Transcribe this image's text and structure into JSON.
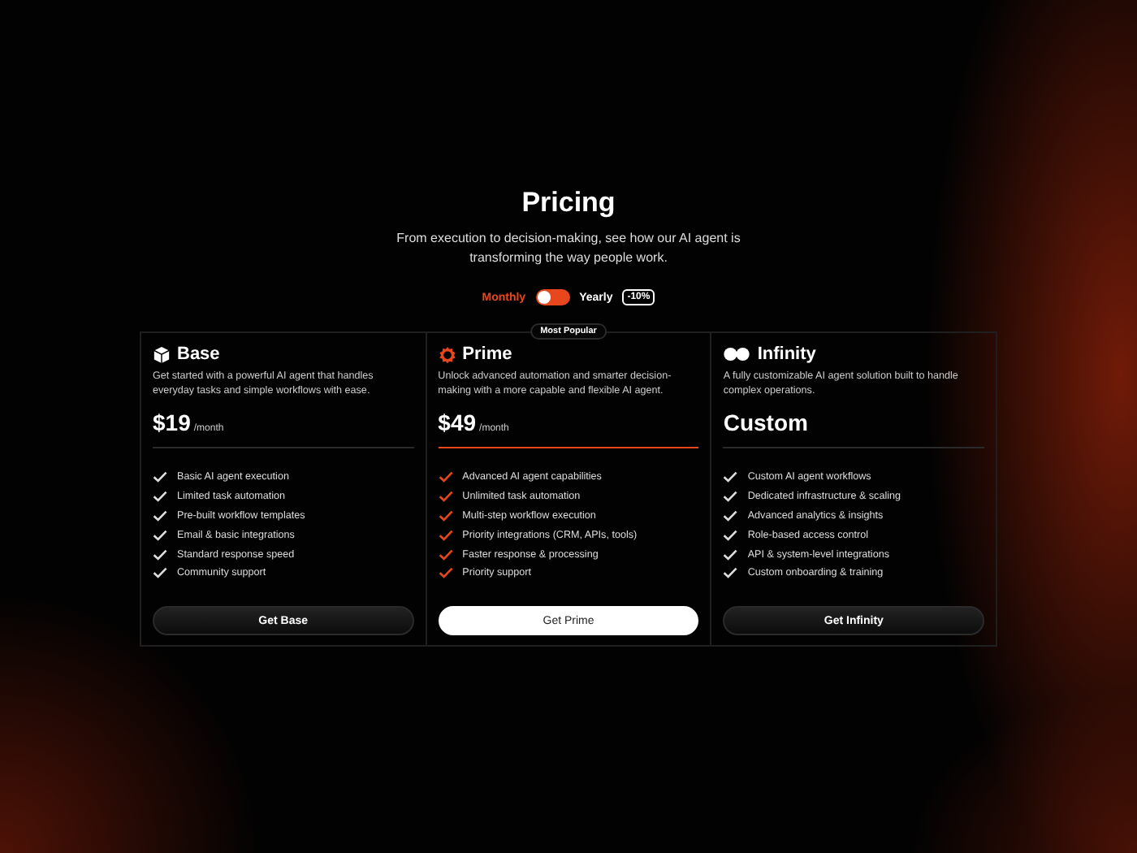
{
  "header": {
    "title": "Pricing",
    "subtitle": "From execution to decision-making, see how our AI agent is transforming the way people work."
  },
  "billing": {
    "options": [
      {
        "label": "Monthly",
        "selected": true
      },
      {
        "label": "Yearly",
        "selected": false
      }
    ],
    "discount": "-10%"
  },
  "plans": [
    {
      "name": "Base",
      "featured": false,
      "description": "Get started with a powerful AI agent that handles everyday tasks and simple workflows with ease.",
      "price": "$19",
      "period": "/month",
      "features": [
        "Basic AI agent execution",
        "Limited task automation",
        "Pre-built workflow templates",
        "Email & basic integrations",
        "Standard response speed",
        "Community support"
      ],
      "button": "Get Base"
    },
    {
      "name": "Prime",
      "featured": true,
      "badge": "Most Popular",
      "description": "Unlock advanced automation and smarter decision-making with a more capable and flexible AI agent.",
      "price": "$49",
      "period": "/month",
      "features": [
        "Advanced AI agent capabilities",
        "Unlimited task automation",
        "Multi-step workflow execution",
        "Priority integrations (CRM, APIs, tools)",
        "Faster response & processing",
        "Priority support"
      ],
      "button": "Get Prime"
    },
    {
      "name": "Infinity",
      "featured": false,
      "description": "A fully customizable AI agent solution built to handle complex operations.",
      "price": "Custom",
      "features": [
        "Custom AI agent workflows",
        "Dedicated infrastructure & scaling",
        "Advanced analytics & insights",
        "Role-based access control",
        "API & system-level integrations",
        "Custom onboarding & training"
      ],
      "button": "Get Infinity"
    }
  ]
}
